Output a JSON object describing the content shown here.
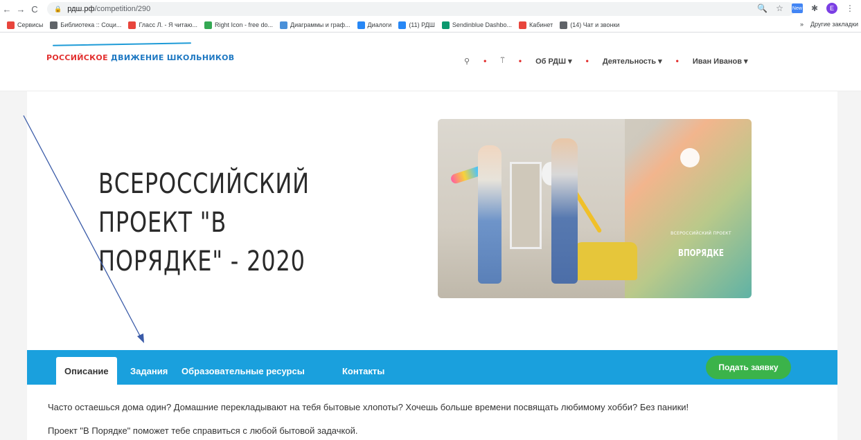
{
  "browser": {
    "url_host": "рдш.рф",
    "url_path": "/competition/290",
    "bookmarks": [
      {
        "label": "Сервисы",
        "color": "#e8453c"
      },
      {
        "label": "Библиотека :: Соци...",
        "color": "#5f6368"
      },
      {
        "label": "Гласс Л. - Я читаю...",
        "color": "#e8453c"
      },
      {
        "label": "Right Icon - free do...",
        "color": "#34a853"
      },
      {
        "label": "Диаграммы и граф...",
        "color": "#4a90d9"
      },
      {
        "label": "Диалоги",
        "color": "#2787f5"
      },
      {
        "label": "(11) РДШ",
        "color": "#2787f5"
      },
      {
        "label": "Sendinblue Dashbo...",
        "color": "#0b996e"
      },
      {
        "label": "Кабинет",
        "color": "#e8453c"
      },
      {
        "label": "(14) Чат и звонки",
        "color": "#5f6368"
      }
    ],
    "bookmarks_more": "»",
    "other_bookmarks": "Другие закладки",
    "ext_badge": "New",
    "profile_initial": "E"
  },
  "site": {
    "logo_part1": "РОССИЙСКОЕ",
    "logo_part2": "ДВИЖЕНИЕ ШКОЛЬНИКОВ",
    "menu": {
      "about": "Об РДШ ▾",
      "activity": "Деятельность ▾",
      "user": "Иван Иванов ▾"
    }
  },
  "hero": {
    "title": "ВСЕРОССИЙСКИЙ ПРОЕКТ \"В ПОРЯДКЕ\" - 2020",
    "banner_kicker": "ВСЕРОССИЙСКИЙ ПРОЕКТ",
    "banner_title": "ВПОРЯДКЕ"
  },
  "tabs": [
    "Описание",
    "Задания",
    "Образовательные ресурсы",
    "Контакты"
  ],
  "apply_button": "Подать заявку",
  "description": [
    "Часто остаешься дома один? Домашние перекладывают на тебя бытовые хлопоты? Хочешь больше времени посвящать любимому хобби? Без паники!",
    "Проект \"В Порядке\" поможет тебе справиться с любой бытовой задачкой."
  ],
  "colors": {
    "tabs_bar": "#1aa0dd",
    "apply_button": "#3bb34a",
    "logo_red": "#e2302f",
    "logo_blue": "#1e78c2",
    "annotation_arrow": "#3a5ba8"
  }
}
